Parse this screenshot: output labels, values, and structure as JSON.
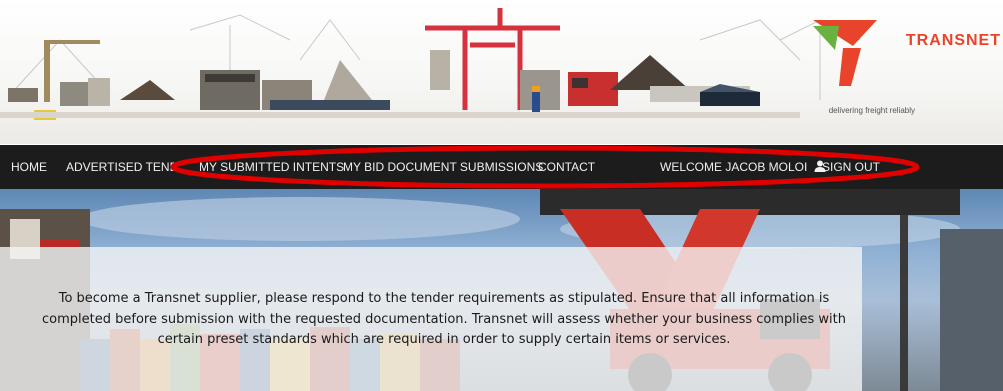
{
  "brand": {
    "name": "TRANSNET",
    "tagline": "delivering freight reliably",
    "colors": {
      "red": "#e8432b",
      "green": "#6ab23f"
    }
  },
  "nav": {
    "items": [
      {
        "label": "HOME"
      },
      {
        "label": "ADVERTISED TENDERS"
      },
      {
        "label": "MY SUBMITTED INTENTS"
      },
      {
        "label": "MY BID DOCUMENT SUBMISSIONS"
      },
      {
        "label": "CONTACT"
      }
    ],
    "welcome": "WELCOME JACOB MOLOI",
    "user_icon": "user-icon",
    "sign_out": "SIGN OUT",
    "annotation_color": "#e00000"
  },
  "hero": {
    "intro": "To become a Transnet supplier, please respond to the tender requirements as stipulated. Ensure that all information is completed before submission with the requested documentation. Transnet will assess whether your business complies with certain preset standards which are required in order to supply certain items or services."
  }
}
